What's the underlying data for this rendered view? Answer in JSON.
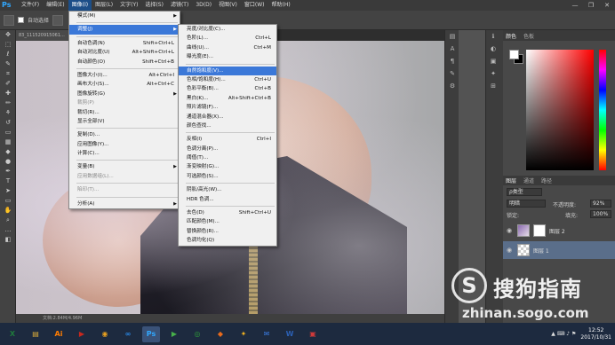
{
  "app": {
    "logo": "Ps"
  },
  "menubar": {
    "items": [
      "文件(F)",
      "编辑(E)",
      "图像(I)",
      "图层(L)",
      "文字(Y)",
      "选择(S)",
      "滤镜(T)",
      "3D(D)",
      "视图(V)",
      "窗口(W)",
      "帮助(H)"
    ],
    "active_index": 2,
    "window_controls": [
      "—",
      "❐",
      "✕"
    ]
  },
  "optbar": {
    "auto_select": "自动选择",
    "tool_icon": "move-tool-icon"
  },
  "document": {
    "tab_label": "83_111520915061...",
    "status": "文档:2.84M/4.96M"
  },
  "image_menu": {
    "items": [
      {
        "label": "模式(M)",
        "submenu": true
      },
      {
        "sep": true
      },
      {
        "label": "调整(J)",
        "submenu": true,
        "highlight": true
      },
      {
        "sep": true
      },
      {
        "label": "自动色调(N)",
        "shortcut": "Shift+Ctrl+L"
      },
      {
        "label": "自动对比度(U)",
        "shortcut": "Alt+Shift+Ctrl+L"
      },
      {
        "label": "自动颜色(O)",
        "shortcut": "Shift+Ctrl+B"
      },
      {
        "sep": true
      },
      {
        "label": "图像大小(I)...",
        "shortcut": "Alt+Ctrl+I"
      },
      {
        "label": "画布大小(S)...",
        "shortcut": "Alt+Ctrl+C"
      },
      {
        "label": "图像旋转(G)",
        "submenu": true
      },
      {
        "label": "裁剪(P)",
        "disabled": true
      },
      {
        "label": "裁切(R)..."
      },
      {
        "label": "显示全部(V)"
      },
      {
        "sep": true
      },
      {
        "label": "复制(D)..."
      },
      {
        "label": "应用图像(Y)..."
      },
      {
        "label": "计算(C)..."
      },
      {
        "sep": true
      },
      {
        "label": "变量(B)",
        "submenu": true
      },
      {
        "label": "应用数据组(L)...",
        "disabled": true
      },
      {
        "sep": true
      },
      {
        "label": "陷印(T)...",
        "disabled": true
      },
      {
        "sep": true
      },
      {
        "label": "分析(A)",
        "submenu": true
      }
    ]
  },
  "adjust_menu": {
    "items": [
      {
        "label": "亮度/对比度(C)..."
      },
      {
        "label": "色阶(L)...",
        "shortcut": "Ctrl+L"
      },
      {
        "label": "曲线(U)...",
        "shortcut": "Ctrl+M"
      },
      {
        "label": "曝光度(E)..."
      },
      {
        "sep": true
      },
      {
        "label": "自然饱和度(V)...",
        "highlight": true
      },
      {
        "label": "色相/饱和度(H)...",
        "shortcut": "Ctrl+U"
      },
      {
        "label": "色彩平衡(B)...",
        "shortcut": "Ctrl+B"
      },
      {
        "label": "黑白(K)...",
        "shortcut": "Alt+Shift+Ctrl+B"
      },
      {
        "label": "照片滤镜(F)..."
      },
      {
        "label": "通道混合器(X)..."
      },
      {
        "label": "颜色查找..."
      },
      {
        "sep": true
      },
      {
        "label": "反相(I)",
        "shortcut": "Ctrl+I"
      },
      {
        "label": "色调分离(P)..."
      },
      {
        "label": "阈值(T)..."
      },
      {
        "label": "渐变映射(G)..."
      },
      {
        "label": "可选颜色(S)..."
      },
      {
        "sep": true
      },
      {
        "label": "阴影/高光(W)..."
      },
      {
        "label": "HDR 色调..."
      },
      {
        "sep": true
      },
      {
        "label": "去色(D)",
        "shortcut": "Shift+Ctrl+U"
      },
      {
        "label": "匹配颜色(M)..."
      },
      {
        "label": "替换颜色(R)..."
      },
      {
        "label": "色调均化(Q)"
      }
    ]
  },
  "color_panel": {
    "tabs": [
      "颜色",
      "色板"
    ],
    "fg": "#ffffff",
    "bg": "#000000",
    "hue": "#ff0000"
  },
  "layers_panel": {
    "tabs": [
      "图层",
      "通道",
      "路径"
    ],
    "kind_label": "ρ类型",
    "blend_mode": "明暗",
    "opacity_label": "不透明度:",
    "opacity_value": "92%",
    "lock_label": "锁定:",
    "fill_label": "填充:",
    "fill_value": "100%",
    "layers": [
      {
        "name": "图层 2",
        "selected": false
      },
      {
        "name": "图层 1",
        "selected": true
      }
    ]
  },
  "watermark": {
    "logo": "S",
    "name": "搜狗指南",
    "url": "zhinan.sogo.com"
  },
  "taskbar": {
    "apps": [
      {
        "label": "X",
        "color": "#1f7a3c",
        "icon": "excel-icon"
      },
      {
        "label": "▤",
        "color": "#d8a93a",
        "icon": "explorer-icon"
      },
      {
        "label": "Ai",
        "color": "#ff7c00",
        "icon": "illustrator-icon"
      },
      {
        "label": "▶",
        "color": "#c8281e",
        "icon": "media-player-icon"
      },
      {
        "label": "◉",
        "color": "#e8a020",
        "icon": "browser-icon"
      },
      {
        "label": "∞",
        "color": "#2a8ae8",
        "icon": "baidu-icon"
      },
      {
        "label": "Ps",
        "color": "#31a8ff",
        "icon": "photoshop-icon",
        "active": true
      },
      {
        "label": "▶",
        "color": "#47b04a",
        "icon": "play-store-icon"
      },
      {
        "label": "◎",
        "color": "#2e9a3a",
        "icon": "ie-icon"
      },
      {
        "label": "◆",
        "color": "#e86a1c",
        "icon": "tool-icon"
      },
      {
        "label": "✦",
        "color": "#f0b020",
        "icon": "app-icon"
      },
      {
        "label": "✉",
        "color": "#3a7be0",
        "icon": "mail-icon"
      },
      {
        "label": "W",
        "color": "#2b5fb4",
        "icon": "word-icon"
      },
      {
        "label": "▣",
        "color": "#d03a3a",
        "icon": "chart-app-icon"
      }
    ],
    "time": "12:52",
    "date": "2017/10/31"
  }
}
